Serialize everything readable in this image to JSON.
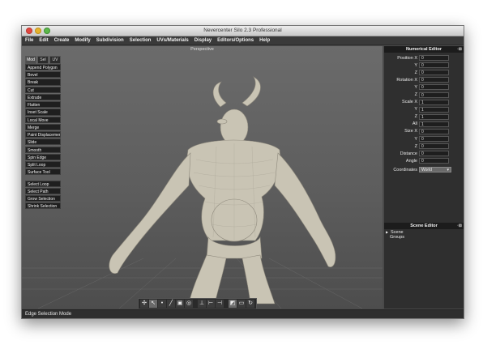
{
  "window": {
    "title": "Nevercenter Silo 2.3 Professional"
  },
  "menu": [
    "File",
    "Edit",
    "Create",
    "Modify",
    "Subdivision",
    "Selection",
    "UVs/Materials",
    "Display",
    "Editors/Options",
    "Help"
  ],
  "viewport": {
    "label": "Perspective"
  },
  "tool_tabs": [
    {
      "label": "Mod",
      "active": true
    },
    {
      "label": "Sel",
      "active": false
    },
    {
      "label": "UV",
      "active": false
    }
  ],
  "tools_group1": [
    "Append Polygon",
    "Bevel",
    "Break",
    "Cut",
    "Extrude",
    "Flatten",
    "Inset Scale",
    "Local Move",
    "Merge",
    "Paint Displacement",
    "Slide",
    "Smooth",
    "Spin Edge",
    "Split Loop",
    "Surface Tool"
  ],
  "tools_group2": [
    "Select Loop",
    "Select Path",
    "Grow Selection",
    "Shrink Selection"
  ],
  "numerical_editor": {
    "title": "Numerical Editor",
    "rows": [
      {
        "label": "Position X",
        "value": "0"
      },
      {
        "label": "Y",
        "value": "0"
      },
      {
        "label": "Z",
        "value": "0"
      },
      {
        "label": "Rotation X",
        "value": "0"
      },
      {
        "label": "Y",
        "value": "0"
      },
      {
        "label": "Z",
        "value": "0"
      },
      {
        "label": "Scale X",
        "value": "1"
      },
      {
        "label": "Y",
        "value": "1"
      },
      {
        "label": "Z",
        "value": "1"
      },
      {
        "label": "All",
        "value": "1"
      },
      {
        "label": "Size X",
        "value": "0"
      },
      {
        "label": "Y",
        "value": "0"
      },
      {
        "label": "Z",
        "value": "0"
      },
      {
        "label": "Distance",
        "value": "0"
      },
      {
        "label": "Angle",
        "value": "0"
      }
    ],
    "coordinates_label": "Coordinates",
    "coordinates_value": "World"
  },
  "scene_editor": {
    "title": "Scene Editor",
    "root": "Scene",
    "child": "Groups"
  },
  "status": {
    "text": "Edge Selection Mode"
  },
  "bottom_toolbar_icons": [
    "transform-icon",
    "select-icon",
    "vertex-icon",
    "edge-icon",
    "face-icon",
    "object-icon",
    "axis-x-icon",
    "axis-y-icon",
    "axis-z-icon",
    "paint-select-icon",
    "camera-icon",
    "refresh-icon"
  ]
}
